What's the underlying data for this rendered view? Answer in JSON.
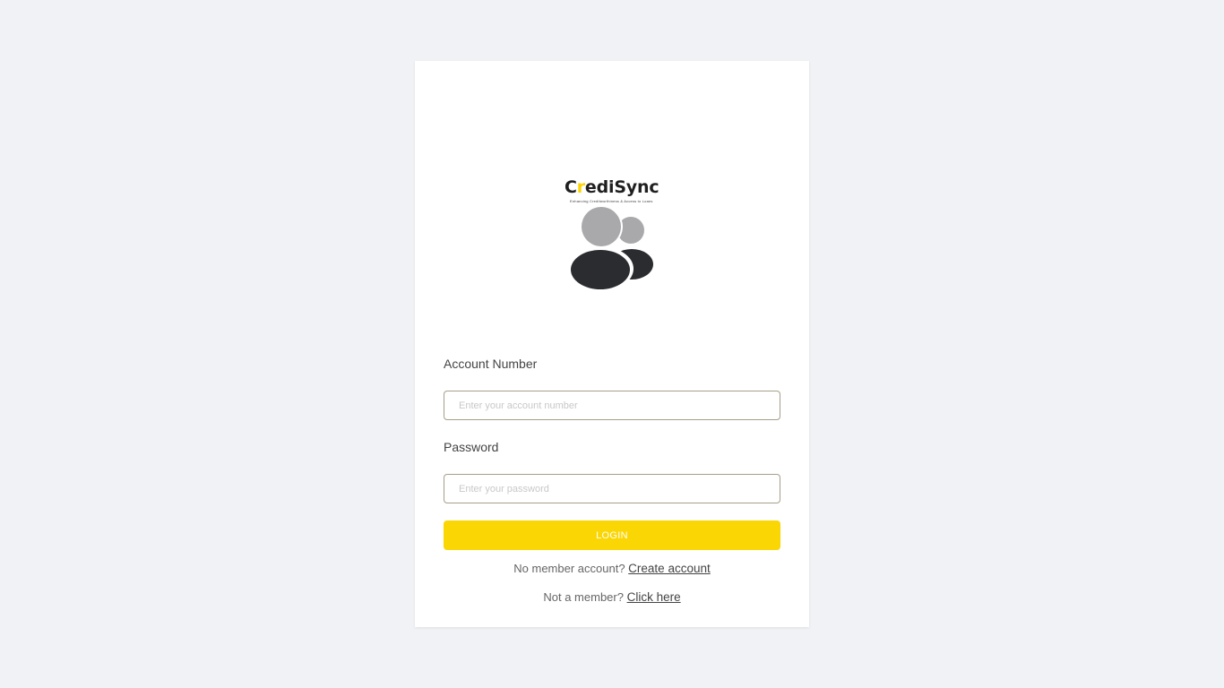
{
  "brand": {
    "name_prefix": "C",
    "name_accent": "r",
    "name_suffix": "ediSync",
    "tagline": "Enhancing Creditworthiness & Access to Loans",
    "accent_color": "#fcd400"
  },
  "avatar": {
    "icon": "users-icon"
  },
  "form": {
    "account_label": "Account Number",
    "account_placeholder": "Enter your account number",
    "password_label": "Password",
    "password_placeholder": "Enter your password",
    "login_label": "LOGIN",
    "button_color": "#fbd605"
  },
  "links": {
    "no_account_text": "No member account?",
    "create_account_link": "Create account",
    "not_member_text": "Not a member?",
    "click_here_link": "Click here"
  }
}
